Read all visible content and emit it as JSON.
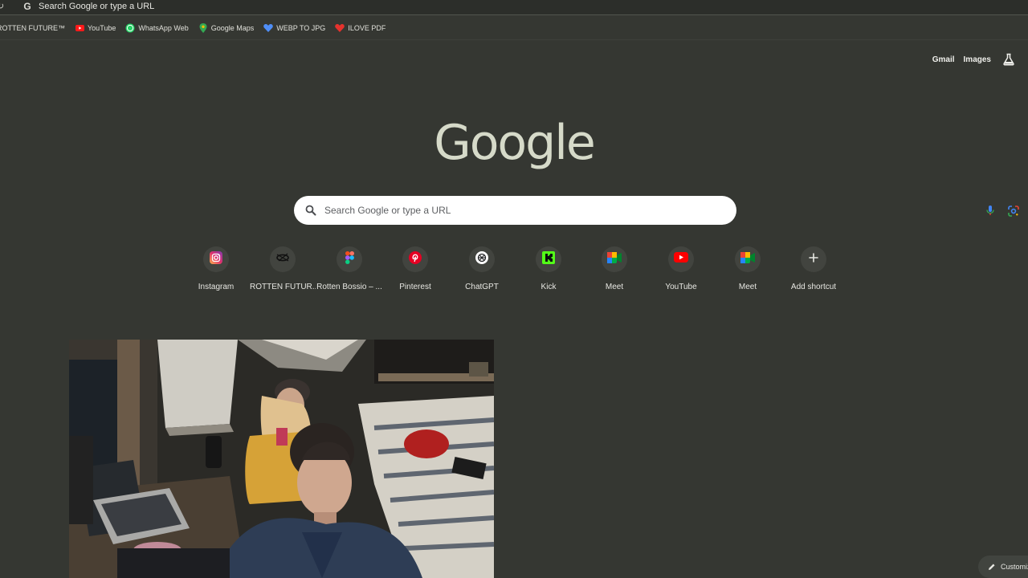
{
  "omnibox": {
    "text": "Search Google or type a URL"
  },
  "bookmarks": [
    {
      "label": "ROTTEN FUTURE™",
      "icon": "none"
    },
    {
      "label": "YouTube",
      "icon": "youtube-icon"
    },
    {
      "label": "WhatsApp Web",
      "icon": "whatsapp-icon"
    },
    {
      "label": "Google Maps",
      "icon": "maps-pin-icon"
    },
    {
      "label": "WEBP TO JPG",
      "icon": "heart-blue-icon"
    },
    {
      "label": "ILOVE PDF",
      "icon": "heart-red-icon"
    }
  ],
  "header": {
    "gmail": "Gmail",
    "images": "Images"
  },
  "logo": "Google",
  "search": {
    "placeholder": "Search Google or type a URL"
  },
  "shortcuts": [
    {
      "label": "Instagram",
      "icon": "instagram-icon"
    },
    {
      "label": "ROTTEN FUTUR...",
      "icon": "rotten-future-icon"
    },
    {
      "label": "Rotten Bossio – ...",
      "icon": "figma-icon"
    },
    {
      "label": "Pinterest",
      "icon": "pinterest-icon"
    },
    {
      "label": "ChatGPT",
      "icon": "chatgpt-icon"
    },
    {
      "label": "Kick",
      "icon": "kick-icon"
    },
    {
      "label": "Meet",
      "icon": "meet-icon"
    },
    {
      "label": "YouTube",
      "icon": "youtube-icon"
    },
    {
      "label": "Meet",
      "icon": "meet-icon"
    },
    {
      "label": "Add shortcut",
      "icon": "plus-icon"
    }
  ],
  "customize": {
    "label": "Customize"
  }
}
